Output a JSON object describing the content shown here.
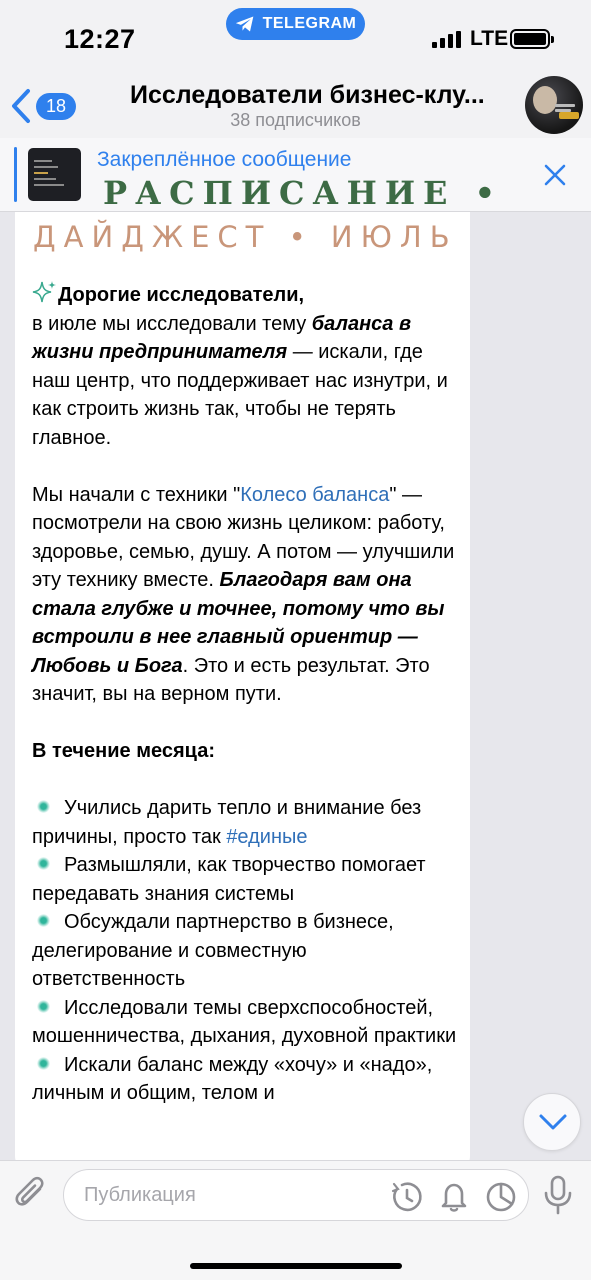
{
  "status_bar": {
    "time": "12:27",
    "return_app": "TELEGRAM",
    "network": "LTE"
  },
  "header": {
    "back_count": "18",
    "title": "Исследователи бизнес-клу...",
    "subtitle": "38 подписчиков"
  },
  "pinned": {
    "label": "Закреплённое сообщение",
    "preview": "РАСПИСАНИЕ • ИЮЛЬ"
  },
  "message": {
    "header_image_text": "ДАЙДЖЕСТ • ИЮЛЬ",
    "greeting": "Дорогие исследователи,",
    "p1_a": "в июле мы исследовали тему ",
    "p1_b": "баланса в жизни предпринимателя",
    "p1_c": " — искали, где наш центр, что поддерживает нас изнутри, и как строить жизнь так, чтобы не терять главное.",
    "p2_a": "Мы начали с техники \"",
    "p2_link": "Колесо баланса",
    "p2_b": "\" — посмотрели на свою жизнь целиком: работу, здоровье, семью, душу. А потом — улучшили эту технику вместе.",
    "p2_bold": "Благодаря вам она стала глубже и точнее, потому что вы встроили в нее главный ориентир — Любовь и Бога",
    "p2_c": ". Это и есть результат. Это значит, вы на верном пути.",
    "section_title": "В течение месяца:",
    "items": [
      {
        "text": "Учились дарить тепло и внимание без причины, просто так ",
        "tag": "#единые"
      },
      {
        "text": "Размышляли, как творчество помогает передавать знания системы",
        "tag": ""
      },
      {
        "text": "Обсуждали партнерство в бизнесе, делегирование и совместную ответственность",
        "tag": ""
      },
      {
        "text": "Исследовали темы сверхспособностей, мошенничества, дыхания, духовной практики",
        "tag": ""
      },
      {
        "text": "Искали баланс между «хочу» и «надо», личным и общим, телом и",
        "tag": ""
      }
    ]
  },
  "composer": {
    "placeholder": "Публикация"
  },
  "colors": {
    "accent": "#2f80ed",
    "link": "#2f6fb8",
    "pinned_banner": "#3d6b45",
    "digest_title": "#c9967a"
  }
}
